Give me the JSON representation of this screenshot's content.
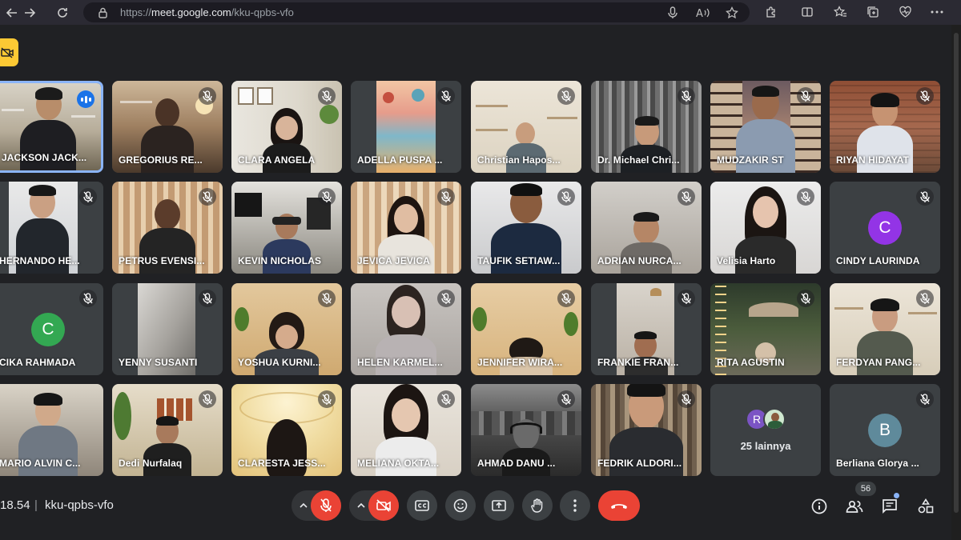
{
  "browser": {
    "url_prefix": "https://",
    "url_host": "meet.google.com",
    "url_path": "/kku-qpbs-vfo"
  },
  "colors": {
    "accent": "#8ab4f8",
    "speaking_badge": "#1a73e8",
    "danger": "#ea4335",
    "notice": "#fcc934",
    "tile_bg": "#3c4043"
  },
  "participants": [
    {
      "name": "JACKSON JACK...",
      "speaking": true,
      "video": true
    },
    {
      "name": "GREGORIUS RE...",
      "video": true
    },
    {
      "name": "CLARA ANGELA",
      "video": true
    },
    {
      "name": "ADELLA PUSPA ...",
      "video": true
    },
    {
      "name": "Christian Hapos...",
      "video": true
    },
    {
      "name": "Dr. Michael Chri...",
      "video": true
    },
    {
      "name": "MUDZAKIR ST",
      "video": true
    },
    {
      "name": "RIYAN HIDAYAT",
      "video": true
    },
    {
      "name": "HERNANDO HE...",
      "video": true
    },
    {
      "name": "PETRUS EVENSI...",
      "video": true
    },
    {
      "name": "KEVIN NICHOLAS",
      "video": true
    },
    {
      "name": "JEVICA JEVICA",
      "video": true
    },
    {
      "name": "TAUFIK SETIAW...",
      "video": true
    },
    {
      "name": "ADRIAN NURCA...",
      "video": true
    },
    {
      "name": "Velisia Harto",
      "video": true
    },
    {
      "name": "CINDY LAURINDA",
      "video": false,
      "initial": "C",
      "avatar_color": "#9334e6"
    },
    {
      "name": "CIKA RAHMADA",
      "video": false,
      "initial": "C",
      "avatar_color": "#33a852"
    },
    {
      "name": "YENNY SUSANTI",
      "video": true
    },
    {
      "name": "YOSHUA KURNI...",
      "video": true
    },
    {
      "name": "HELEN KARMEL...",
      "video": true
    },
    {
      "name": "JENNIFER WIRA...",
      "video": true
    },
    {
      "name": "FRANKIE FRAN...",
      "video": true
    },
    {
      "name": "RITA AGUSTIN",
      "video": true
    },
    {
      "name": "FERDYAN PANG...",
      "video": true
    },
    {
      "name": "MARIO ALVIN C...",
      "video": true
    },
    {
      "name": "Dedi Nurfalaq",
      "video": true
    },
    {
      "name": "CLARESTA JESS...",
      "video": true
    },
    {
      "name": "MELIANA OKTA...",
      "video": true
    },
    {
      "name": "AHMAD DANU ...",
      "video": true
    },
    {
      "name": "FEDRIK ALDORI...",
      "video": true
    },
    {
      "name": "Berliana Glorya ...",
      "video": false,
      "initial": "B",
      "avatar_color": "#5f8a9b"
    }
  ],
  "more_tile": {
    "label": "25 lainnya",
    "avatar_initial": "R",
    "avatar_color": "#7b54c4"
  },
  "bottom_bar": {
    "time": "18.54",
    "separator": "|",
    "meeting_code": "kku-qpbs-vfo",
    "people_count": "56"
  }
}
